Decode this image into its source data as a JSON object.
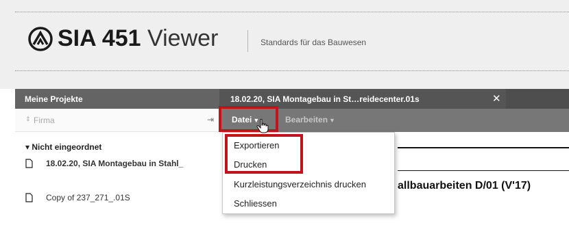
{
  "header": {
    "title_bold": "SIA 451",
    "title_light": "Viewer",
    "subtitle": "Standards für das Bauwesen",
    "logo_icon": "sia-logo-icon"
  },
  "left_panel": {
    "title": "Meine Projekte",
    "sort_icon": "sort-arrows-icon",
    "sort_field": "Firma",
    "collapse_icon": "collapse-panel-icon",
    "group_label": "Nicht eingeordnet",
    "files": [
      {
        "name": "18.02.20, SIA Montagebau in Stahl_",
        "bold": true,
        "icon": "file-icon"
      },
      {
        "name": "Copy of 237_271_.01S",
        "bold": false,
        "icon": "file-icon"
      }
    ]
  },
  "document": {
    "tab_title": "18.02.20, SIA Montagebau in St…reidecenter.01s",
    "tab_close_icon": "close-icon",
    "heading": "allbauarbeiten D/01 (V'17)"
  },
  "menu": {
    "datei": "Datei",
    "bearbeiten": "Bearbeiten",
    "caret_icon": "chevron-down-icon"
  },
  "datei_dropdown": [
    "Exportieren",
    "Drucken",
    "Kurzleistungsverzeichnis drucken",
    "Schliessen"
  ],
  "colors": {
    "panel_header": "#646464",
    "tab_bar": "#4e4e4e",
    "menu_bar": "#777777",
    "highlight": "#c0141d",
    "header_bg": "#efefef"
  }
}
